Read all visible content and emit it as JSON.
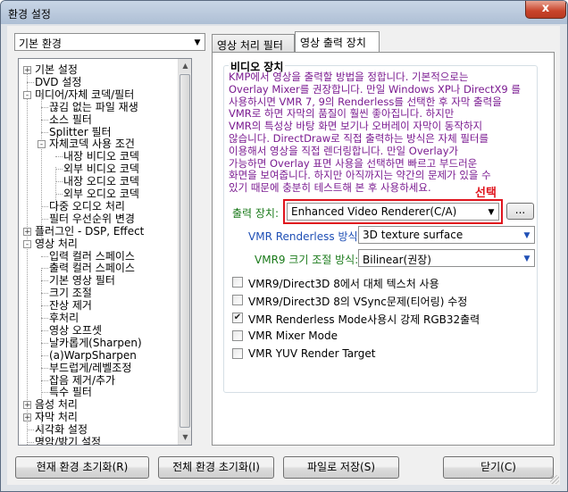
{
  "window": {
    "title": "환경 설정",
    "close_label": "x"
  },
  "profile_combo": {
    "value": "기본 환경"
  },
  "tree": {
    "items": [
      {
        "label": "기본 설정"
      },
      {
        "label": "DVD 설정"
      },
      {
        "label": "미디어/자체 코덱/필터"
      },
      {
        "label": "끊김 없는 파일 재생"
      },
      {
        "label": "소스 필터"
      },
      {
        "label": "Splitter 필터"
      },
      {
        "label": "자체코덱 사용 조건"
      },
      {
        "label": "내장 비디오 코덱"
      },
      {
        "label": "외부 비디오 코덱"
      },
      {
        "label": "내장 오디오 코덱"
      },
      {
        "label": "외부 오디오 코덱"
      },
      {
        "label": "다중 오디오 처리"
      },
      {
        "label": "필터 우선순위 변경"
      },
      {
        "label": "플러그인 - DSP, Effect"
      },
      {
        "label": "영상 처리"
      },
      {
        "label": "입력 컬러 스페이스"
      },
      {
        "label": "출력 컬러 스페이스"
      },
      {
        "label": "기본 영상 필터"
      },
      {
        "label": "크기 조절"
      },
      {
        "label": "잔상 제거"
      },
      {
        "label": "후처리"
      },
      {
        "label": "영상 오프셋"
      },
      {
        "label": "날카롭게(Sharpen)"
      },
      {
        "label": "(a)WarpSharpen"
      },
      {
        "label": "부드럽게/레벨조정"
      },
      {
        "label": "잡음 제거/추가"
      },
      {
        "label": "특수 필터"
      },
      {
        "label": "음성 처리"
      },
      {
        "label": "자막 처리"
      },
      {
        "label": "시각화 설정"
      },
      {
        "label": "명암/밝기 설정"
      }
    ]
  },
  "tabs": [
    {
      "label": "영상 처리 필터"
    },
    {
      "label": "영상 출력 장치"
    }
  ],
  "video_device": {
    "group_title": "비디오 장치",
    "description": "KMP에서 영상을 출력할 방법을 정합니다. 기본적으로는\nOverlay Mixer를 권장합니다. 만일 Windows XP나 DirectX9 를\n사용하시면 VMR 7, 9의 Renderless를 선택한 후 자막 출력을\nVMR로 하면 자막의 품질이 훨씬 좋아집니다. 하지만\nVMR의 특성상 바탕 화면 보기나 오버레이 자막이 동작하지\n않습니다. DirectDraw로 직접 출력하는 방식은 자체 필터를\n이용해서 영상을 직접 렌더링합니다. 만일 Overlay가\n가능하면 Overlay 표면 사용을 선택하면 빠르고 부드러운\n화면을 보여줍니다. 하지만 아직까지는 약간의 문제가 있을 수\n있기 때문에 충분히 테스트해 본 후 사용하세요.",
    "annotation": "선택",
    "output_device_label": "출력 장치:",
    "output_device_value": "Enhanced Video Renderer(C/A)",
    "more_button": "...",
    "renderless_label": "VMR Renderless 방식:",
    "renderless_value": "3D texture surface",
    "resize_label": "VMR9 크기 조절 방식:",
    "resize_value": "Bilinear(권장)",
    "options": [
      {
        "label": "VMR9/Direct3D 8에서 대체 텍스처 사용",
        "checked": false
      },
      {
        "label": "VMR9/Direct3D 8의 VSync문제(티어링) 수정",
        "checked": false
      },
      {
        "label": "VMR Renderless Mode사용시 강제 RGB32출력",
        "checked": true
      },
      {
        "label": "VMR Mixer Mode",
        "checked": false
      },
      {
        "label": "VMR YUV Render Target",
        "checked": false
      }
    ]
  },
  "buttons": {
    "reset_current": "현재 환경 초기화(R)",
    "reset_all": "전체 환경 초기화(I)",
    "save_file": "파일로 저장(S)",
    "close": "닫기(C)"
  }
}
